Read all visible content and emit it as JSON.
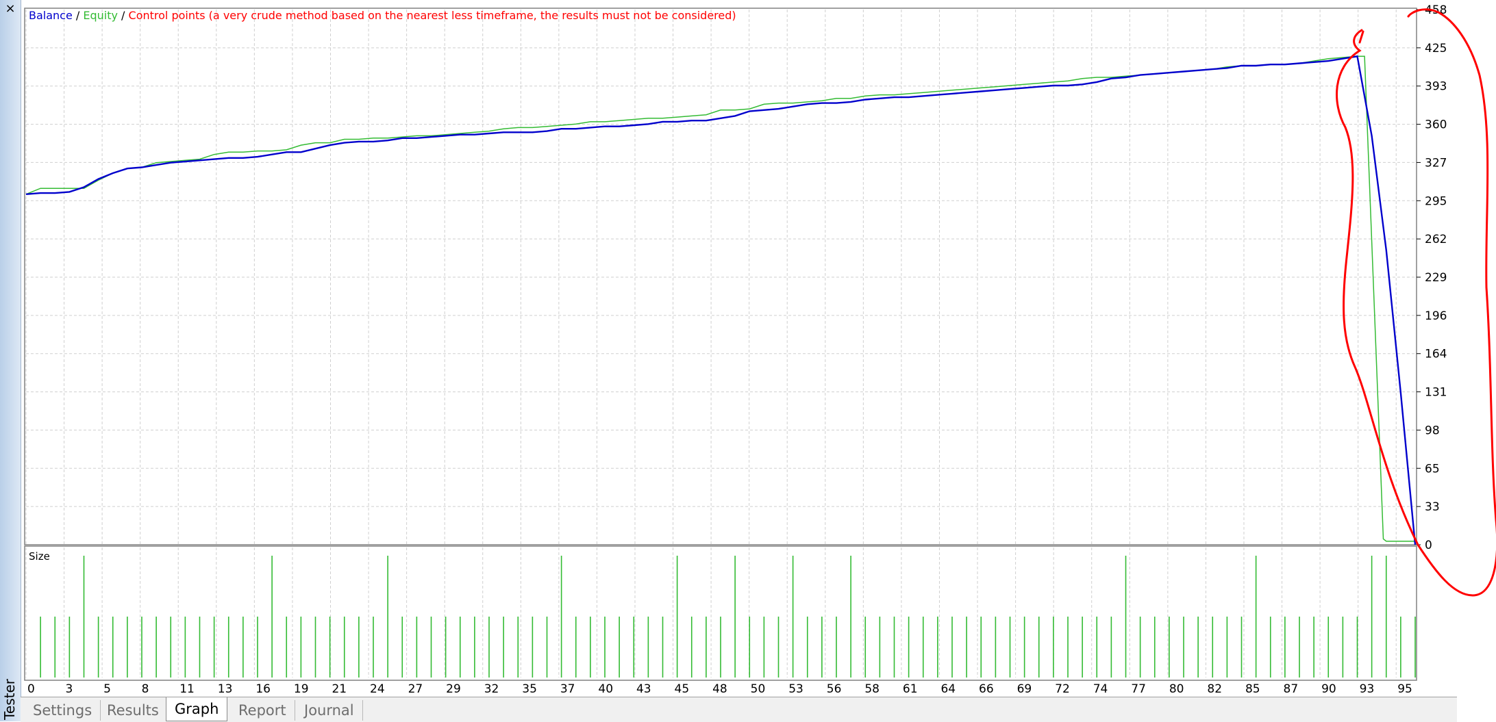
{
  "window": {
    "panel_title": "Tester",
    "close_glyph": "×"
  },
  "tabs": [
    {
      "label": "Settings",
      "active": false
    },
    {
      "label": "Results",
      "active": false
    },
    {
      "label": "Graph",
      "active": true
    },
    {
      "label": "Report",
      "active": false
    },
    {
      "label": "Journal",
      "active": false
    }
  ],
  "legend": {
    "balance": "Balance",
    "sep1": " / ",
    "equity": "Equity",
    "sep2": " / ",
    "control": "Control points (a very crude method based on the nearest less timeframe, the results must not be considered)"
  },
  "colors": {
    "balance": "#0000cc",
    "equity": "#33bb33",
    "control": "#ff0000",
    "annotation": "#ff0000",
    "grid": "#cfcfcf"
  },
  "chart_data": [
    {
      "type": "line",
      "title": "",
      "ylim": [
        0,
        458
      ],
      "y_ticks": [
        "458",
        "425",
        "393",
        "360",
        "327",
        "295",
        "262",
        "229",
        "196",
        "164",
        "131",
        "98",
        "65",
        "33",
        "0"
      ],
      "x_ticks": [
        "0",
        "3",
        "5",
        "8",
        "11",
        "13",
        "16",
        "19",
        "21",
        "24",
        "27",
        "29",
        "32",
        "35",
        "37",
        "40",
        "43",
        "45",
        "48",
        "50",
        "53",
        "56",
        "58",
        "61",
        "64",
        "66",
        "69",
        "72",
        "74",
        "77",
        "80",
        "82",
        "85",
        "87",
        "90",
        "93",
        "95"
      ],
      "x_range": [
        0,
        96
      ],
      "series": [
        {
          "name": "Balance",
          "color": "#0000cc",
          "x": [
            0,
            1,
            2,
            3,
            4,
            5,
            6,
            7,
            8,
            9,
            10,
            11,
            12,
            13,
            14,
            15,
            16,
            17,
            18,
            19,
            20,
            21,
            22,
            23,
            24,
            25,
            26,
            27,
            28,
            29,
            30,
            31,
            32,
            33,
            34,
            35,
            36,
            37,
            38,
            39,
            40,
            41,
            42,
            43,
            44,
            45,
            46,
            47,
            48,
            49,
            50,
            51,
            52,
            53,
            54,
            55,
            56,
            57,
            58,
            59,
            60,
            61,
            62,
            63,
            64,
            65,
            66,
            67,
            68,
            69,
            70,
            71,
            72,
            73,
            74,
            75,
            76,
            77,
            78,
            79,
            80,
            81,
            82,
            83,
            84,
            85,
            86,
            87,
            88,
            89,
            90,
            91,
            92,
            93,
            94,
            95,
            96
          ],
          "y": [
            300,
            301,
            301,
            302,
            306,
            313,
            318,
            322,
            323,
            325,
            327,
            328,
            329,
            330,
            331,
            331,
            332,
            334,
            336,
            336,
            339,
            342,
            344,
            345,
            345,
            346,
            348,
            348,
            349,
            350,
            351,
            351,
            352,
            353,
            353,
            353,
            354,
            356,
            356,
            357,
            358,
            358,
            359,
            360,
            362,
            362,
            363,
            363,
            365,
            367,
            371,
            372,
            373,
            375,
            377,
            378,
            378,
            379,
            381,
            382,
            383,
            383,
            384,
            385,
            386,
            387,
            388,
            389,
            390,
            391,
            392,
            393,
            393,
            394,
            396,
            399,
            400,
            402,
            403,
            404,
            405,
            406,
            407,
            408,
            410,
            410,
            411,
            411,
            412,
            413,
            414,
            416,
            418,
            350,
            252,
            130,
            0
          ]
        },
        {
          "name": "Equity",
          "color": "#33bb33",
          "x": [
            0,
            1,
            4,
            5,
            6,
            7,
            8,
            9,
            10,
            11,
            12,
            13,
            14,
            15,
            16,
            17,
            18,
            19,
            20,
            21,
            22,
            23,
            24,
            25,
            26,
            27,
            28,
            29,
            30,
            31,
            32,
            33,
            34,
            35,
            36,
            37,
            38,
            39,
            40,
            41,
            42,
            43,
            44,
            45,
            46,
            47,
            48,
            49,
            50,
            51,
            52,
            53,
            54,
            55,
            56,
            57,
            58,
            59,
            60,
            61,
            62,
            63,
            64,
            65,
            66,
            67,
            68,
            69,
            70,
            71,
            72,
            73,
            74,
            75,
            76,
            77,
            78,
            79,
            80,
            81,
            82,
            83,
            84,
            85,
            86,
            87,
            88,
            89,
            90,
            91,
            92,
            92.5,
            93.8,
            94,
            95,
            96
          ],
          "y": [
            300,
            305,
            305,
            312,
            318,
            322,
            323,
            327,
            328,
            329,
            330,
            334,
            336,
            336,
            337,
            337,
            338,
            342,
            344,
            344,
            347,
            347,
            348,
            348,
            349,
            350,
            350,
            351,
            352,
            353,
            354,
            356,
            357,
            357,
            358,
            359,
            360,
            362,
            362,
            363,
            364,
            365,
            365,
            366,
            367,
            368,
            372,
            372,
            373,
            377,
            378,
            378,
            379,
            380,
            382,
            382,
            384,
            385,
            385,
            386,
            387,
            388,
            389,
            390,
            391,
            392,
            393,
            394,
            395,
            396,
            397,
            399,
            400,
            400,
            401,
            402,
            403,
            404,
            405,
            406,
            407,
            409,
            410,
            410,
            411,
            411,
            412,
            414,
            416,
            417,
            418,
            418,
            5,
            3,
            3,
            3
          ]
        }
      ]
    },
    {
      "type": "bar",
      "title": "Size",
      "series": [
        {
          "name": "Size",
          "color": "#33bb33",
          "x": [
            1,
            2,
            3,
            4,
            5,
            6,
            7,
            8,
            9,
            10,
            11,
            12,
            13,
            14,
            15,
            16,
            17,
            18,
            19,
            20,
            21,
            22,
            23,
            24,
            25,
            26,
            27,
            28,
            29,
            30,
            31,
            32,
            33,
            34,
            35,
            36,
            37,
            38,
            39,
            40,
            41,
            42,
            43,
            44,
            45,
            46,
            47,
            48,
            49,
            50,
            51,
            52,
            53,
            54,
            55,
            56,
            57,
            58,
            59,
            60,
            61,
            62,
            63,
            64,
            65,
            66,
            67,
            68,
            69,
            70,
            71,
            72,
            73,
            74,
            75,
            76,
            77,
            78,
            79,
            80,
            81,
            82,
            83,
            84,
            85,
            86,
            87,
            88,
            89,
            90,
            91,
            92,
            93,
            94,
            95,
            96
          ],
          "values": [
            0.5,
            0.5,
            0.5,
            1,
            0.5,
            0.5,
            0.5,
            0.5,
            0.5,
            0.5,
            0.5,
            0.5,
            0.5,
            0.5,
            0.5,
            0.5,
            1,
            0.5,
            0.5,
            0.5,
            0.5,
            0.5,
            0.5,
            0.5,
            1,
            0.5,
            0.5,
            0.5,
            0.5,
            0.5,
            0.5,
            0.5,
            0.5,
            0.5,
            0.5,
            0.5,
            1,
            0.5,
            0.5,
            0.5,
            0.5,
            0.5,
            0.5,
            0.5,
            1,
            0.5,
            0.5,
            0.5,
            1,
            0.5,
            0.5,
            0.5,
            1,
            0.5,
            0.5,
            0.5,
            1,
            0.5,
            0.5,
            0.5,
            0.5,
            0.5,
            0.5,
            0.5,
            0.5,
            0.5,
            0.5,
            0.5,
            0.5,
            0.5,
            0.5,
            0.5,
            0.5,
            0.5,
            0.5,
            1,
            0.5,
            0.5,
            0.5,
            0.5,
            0.5,
            0.5,
            0.5,
            0.5,
            1,
            0.5,
            0.5,
            0.5,
            0.5,
            0.5,
            0.5,
            0.5,
            1,
            1,
            0.5,
            0.5
          ]
        }
      ]
    }
  ]
}
